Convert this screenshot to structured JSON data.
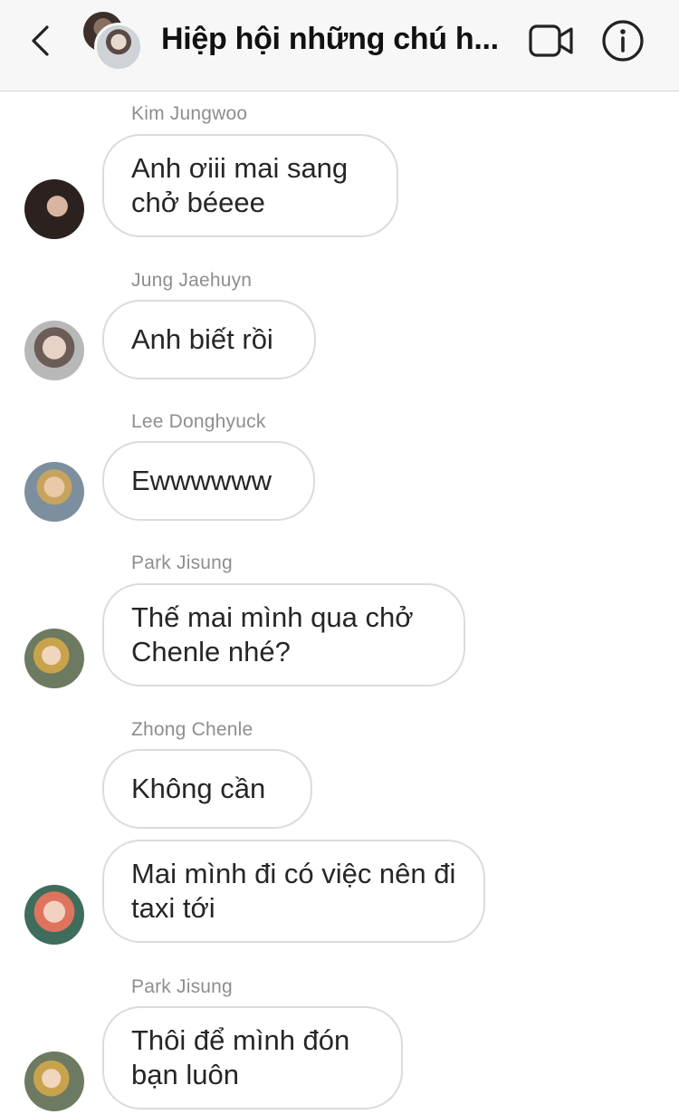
{
  "header": {
    "title": "Hiệp hội những chú h..."
  },
  "messages": [
    {
      "sender": "Kim Jungwoo",
      "text": "Anh ơiii mai sang chở béeee",
      "avatar": "Kim Jungwoo avatar"
    },
    {
      "sender": "Jung Jaehuyn",
      "text": "Anh biết rồi",
      "avatar": "Jung Jaehuyn avatar"
    },
    {
      "sender": "Lee Donghyuck",
      "text": "Ewwwwww",
      "avatar": "Lee Donghyuck avatar"
    },
    {
      "sender": "Park Jisung",
      "text": "Thế mai mình qua chở Chenle nhé?",
      "avatar": "Park Jisung avatar"
    },
    {
      "sender": "Zhong Chenle",
      "texts": [
        "Không cần",
        "Mai mình đi có việc nên đi taxi tới"
      ],
      "avatar": "Zhong Chenle avatar"
    },
    {
      "sender": "Park Jisung",
      "text": "Thôi để mình đón bạn luôn",
      "avatar": "Park Jisung avatar"
    }
  ],
  "icons": {
    "back": "chevron-left-icon",
    "video": "video-camera-icon",
    "info": "info-icon"
  },
  "colors": {
    "header_bg": "#f7f7f7",
    "bubble_border": "#dbdbdb",
    "sender_name": "#8e8e8e",
    "text": "#262626"
  }
}
